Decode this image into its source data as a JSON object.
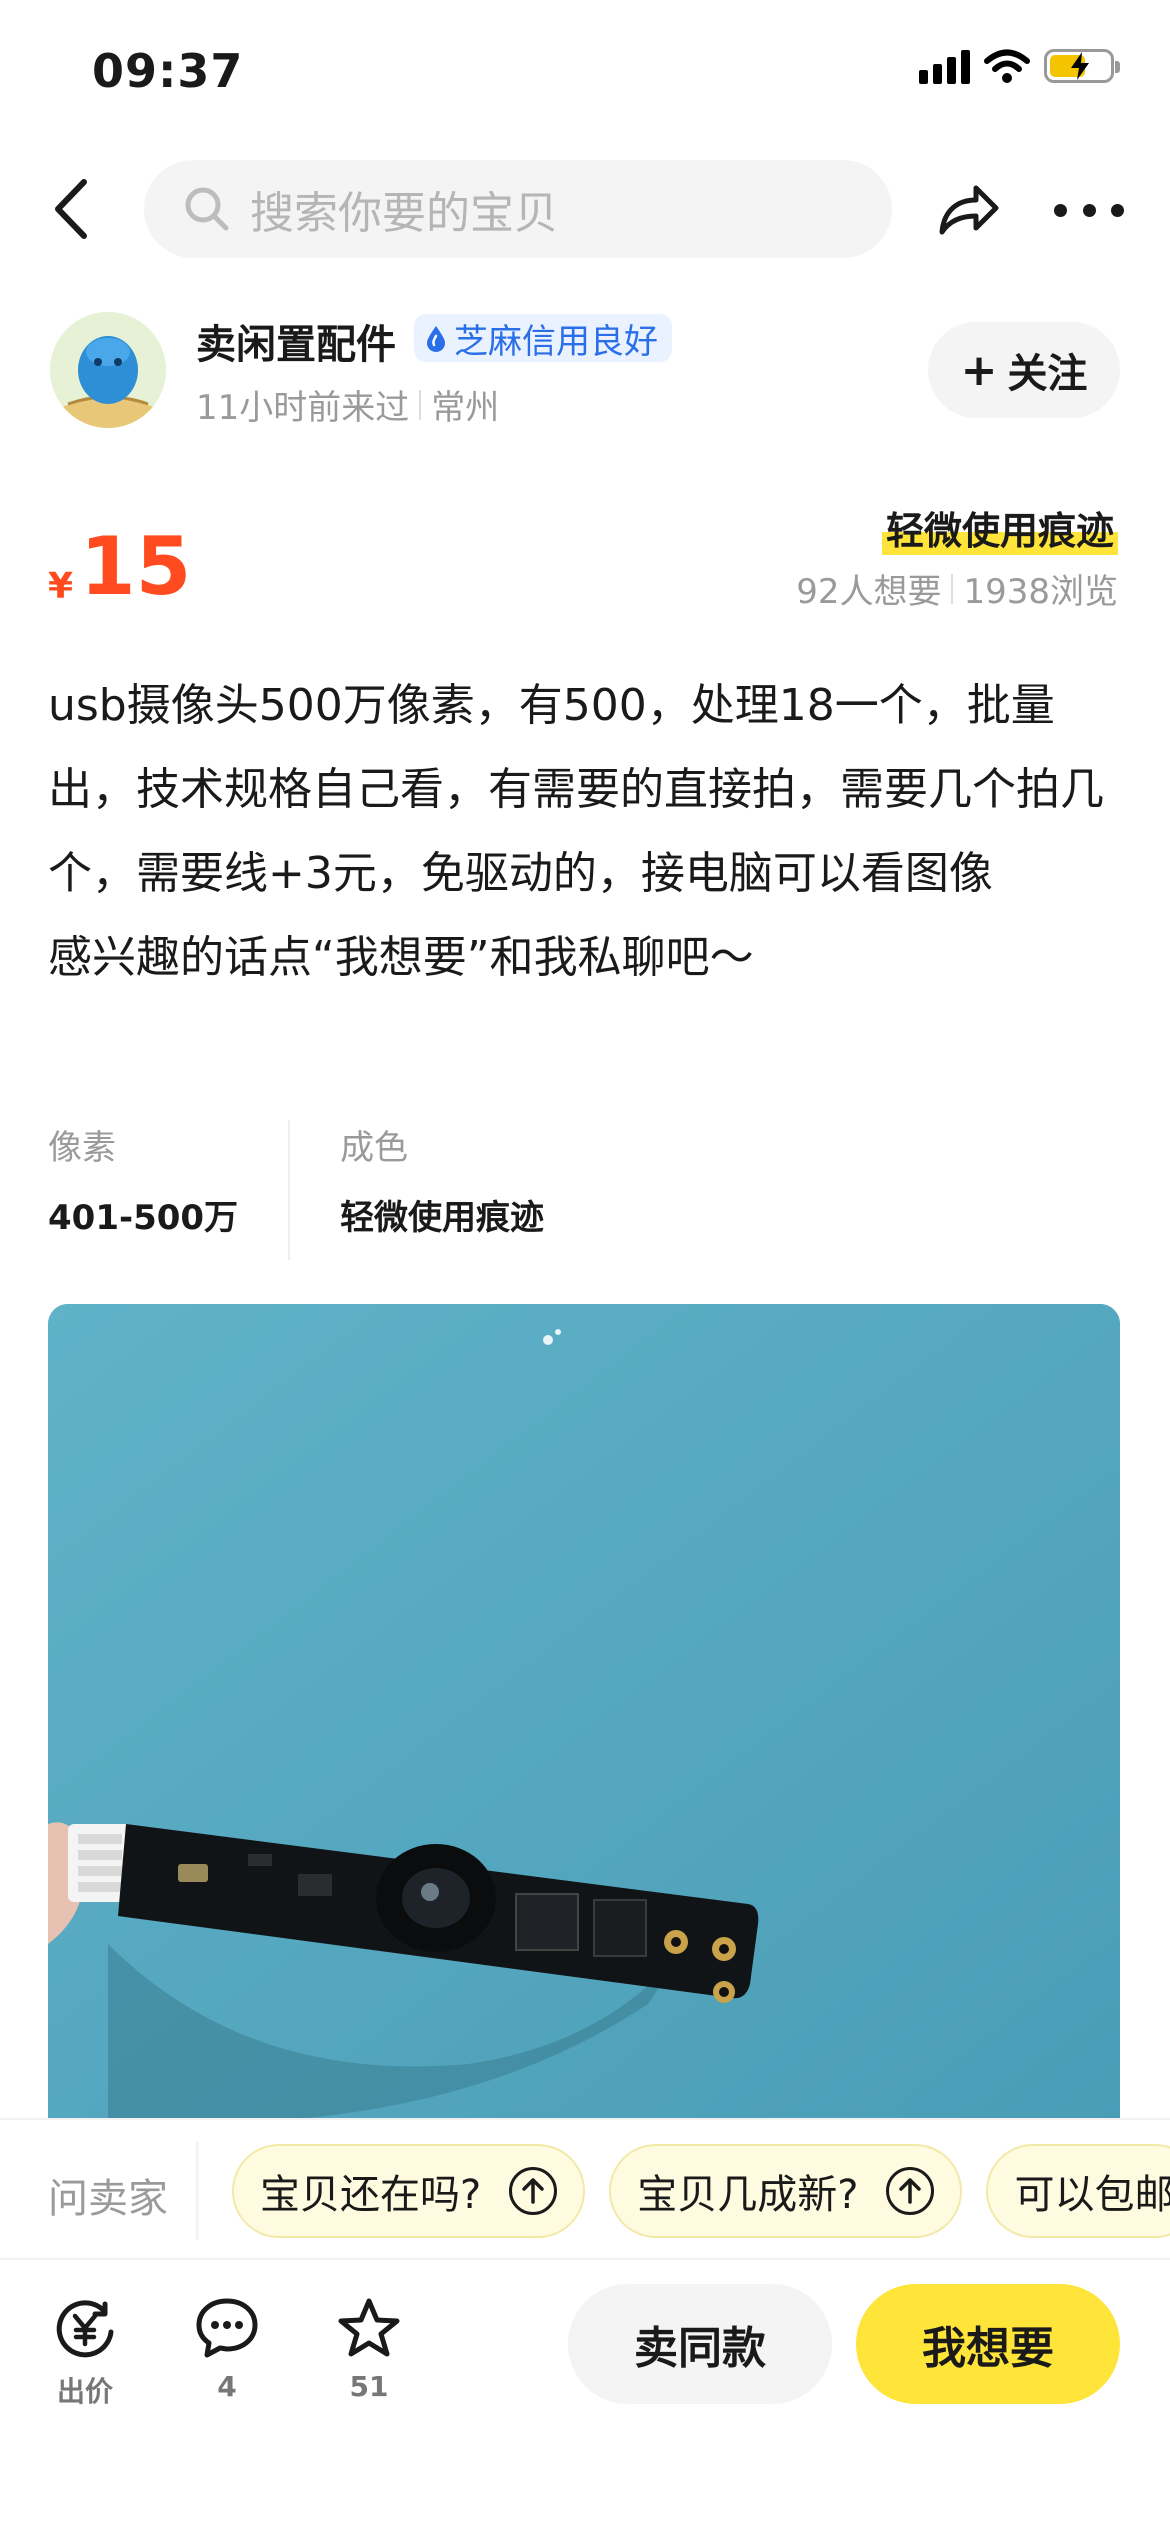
{
  "status_bar": {
    "time": "09:37",
    "icons": [
      "signal-icon",
      "wifi-icon",
      "battery-charging-icon"
    ]
  },
  "nav": {
    "search_placeholder": "搜索你要的宝贝",
    "icons": [
      "back-icon",
      "search-icon",
      "share-icon",
      "more-icon"
    ]
  },
  "seller": {
    "name": "卖闲置配件",
    "credit_badge": "芝麻信用良好",
    "last_seen": "11小时前来过",
    "location": "常州",
    "follow_label": "关注"
  },
  "item": {
    "currency": "¥",
    "price": "15",
    "condition_tag": "轻微使用痕迹",
    "want_count": "92人想要",
    "view_count": "1938浏览",
    "description": "usb摄像头500万像素，有500，处理18一个，批量出，技术规格自己看，有需要的直接拍，需要几个拍几个，需要线+3元，免驱动的，接电脑可以看图像\n感兴趣的话点“我想要”和我私聊吧～",
    "attributes": [
      {
        "key": "像素",
        "value": "401-500万"
      },
      {
        "key": "成色",
        "value": "轻微使用痕迹"
      }
    ]
  },
  "ask": {
    "label": "问卖家",
    "chips": [
      "宝贝还在吗?",
      "宝贝几成新?",
      "可以包邮"
    ]
  },
  "bottom": {
    "offer_label": "出价",
    "comment_count": "4",
    "favorite_count": "51",
    "same_button": "卖同款",
    "want_button": "我想要"
  },
  "colors": {
    "price": "#ff4b1f",
    "accent_yellow": "#ffe53a",
    "credit_blue": "#2b6fe8",
    "image_background": "#55a8bf"
  }
}
